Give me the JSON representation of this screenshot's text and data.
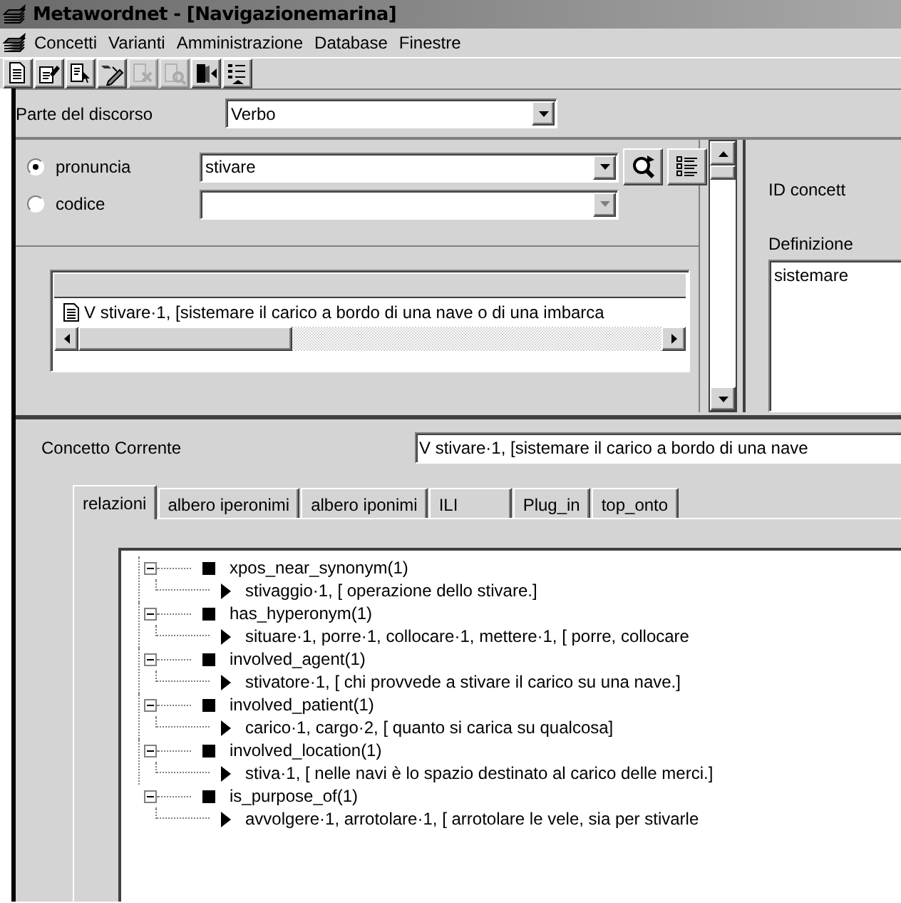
{
  "window": {
    "title": "Metawordnet - [Navigazionemarina]"
  },
  "menu": [
    "Concetti",
    "Varianti",
    "Amministrazione",
    "Database",
    "Finestre"
  ],
  "toolbar": [
    {
      "kind": "new",
      "disabled": false
    },
    {
      "kind": "edit",
      "disabled": false
    },
    {
      "kind": "select",
      "disabled": false
    },
    {
      "kind": "link",
      "disabled": false
    },
    {
      "kind": "delete",
      "disabled": true
    },
    {
      "kind": "find",
      "disabled": true
    },
    {
      "kind": "exit",
      "disabled": false
    },
    {
      "kind": "list",
      "disabled": false
    }
  ],
  "part_of_speech": {
    "label": "Parte del discorso",
    "value": "Verbo"
  },
  "search": {
    "options": [
      {
        "label": "pronuncia",
        "selected": true,
        "value": "stivare",
        "disabled": false
      },
      {
        "label": "codice",
        "selected": false,
        "disabled": true
      }
    ]
  },
  "results": [
    "V stivare·1,  [sistemare il carico a bordo di una nave o di una imbarca"
  ],
  "details": {
    "id_label": "ID concett",
    "definition_label": "Definizione",
    "definition": "sistemare"
  },
  "current": {
    "label": "Concetto Corrente",
    "value": "V stivare·1,  [sistemare il carico a bordo di una nave"
  },
  "tabs": [
    {
      "label": "relazioni",
      "selected": true
    },
    {
      "label": "albero iperonimi",
      "selected": false
    },
    {
      "label": "albero iponimi",
      "selected": false
    },
    {
      "label": "ILI",
      "selected": false
    },
    {
      "label": "Plug_in",
      "selected": false
    },
    {
      "label": "top_onto",
      "selected": false
    }
  ],
  "relations": [
    {
      "label": "xpos_near_synonym(1)",
      "expanded": true,
      "children": [
        {
          "label": "stivaggio·1,  [  operazione dello stivare.]"
        }
      ]
    },
    {
      "label": "has_hyperonym(1)",
      "expanded": true,
      "children": [
        {
          "label": "situare·1,  porre·1,  collocare·1,  mettere·1,  [  porre, collocare"
        }
      ]
    },
    {
      "label": "involved_agent(1)",
      "expanded": true,
      "children": [
        {
          "label": "stivatore·1,  [  chi provvede a stivare il carico su una nave.]"
        }
      ]
    },
    {
      "label": "involved_patient(1)",
      "expanded": true,
      "children": [
        {
          "label": "carico·1,  cargo·2,  [  quanto si carica su qualcosa]"
        }
      ]
    },
    {
      "label": "involved_location(1)",
      "expanded": true,
      "children": [
        {
          "label": "stiva·1,  [  nelle navi è lo spazio destinato al carico delle merci.]"
        }
      ]
    },
    {
      "label": "is_purpose_of(1)",
      "expanded": true,
      "children": [
        {
          "label": "avvolgere·1,  arrotolare·1,  [  arrotolare le vele, sia per stivarle"
        }
      ]
    }
  ]
}
